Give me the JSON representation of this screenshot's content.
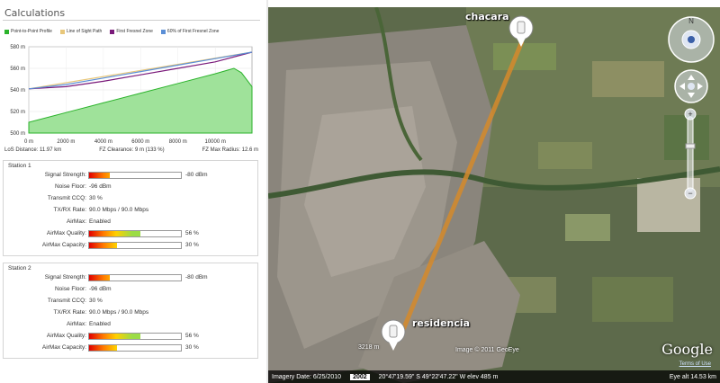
{
  "panel": {
    "title": "Calculations"
  },
  "legend": [
    {
      "label": "Point-to-Point Profile",
      "color": "#2bb32b"
    },
    {
      "label": "Line of Sight Path",
      "color": "#e8c77a"
    },
    {
      "label": "First Fresnel Zone",
      "color": "#7a1a7a"
    },
    {
      "label": "60% of First Fresnel Zone",
      "color": "#5b8fd6"
    }
  ],
  "chart_data": {
    "type": "area",
    "x_unit": "m",
    "xlim": [
      0,
      11970
    ],
    "ylim": [
      500,
      580
    ],
    "x_ticks": [
      "0 m",
      "2000 m",
      "4000 m",
      "6000 m",
      "8000 m",
      "10000 m"
    ],
    "y_ticks": [
      "500 m",
      "520 m",
      "540 m",
      "560 m",
      "580 m"
    ],
    "series": [
      {
        "name": "Point-to-Point Profile",
        "x": [
          0,
          2000,
          4000,
          6000,
          8000,
          10000,
          11000,
          11400,
          11970
        ],
        "y": [
          510,
          519,
          528,
          537,
          546,
          555,
          560,
          556,
          543
        ]
      },
      {
        "name": "Line of Sight Path",
        "x": [
          0,
          11970
        ],
        "y": [
          541,
          575
        ]
      },
      {
        "name": "First Fresnel Zone",
        "x": [
          0,
          2000,
          4000,
          6000,
          8000,
          10000,
          11970
        ],
        "y": [
          541,
          543,
          548,
          554,
          560,
          566,
          575
        ]
      },
      {
        "name": "60% of First Fresnel Zone",
        "x": [
          0,
          2000,
          4000,
          6000,
          8000,
          10000,
          11970
        ],
        "y": [
          541,
          545,
          551,
          557,
          563,
          569,
          575
        ]
      }
    ]
  },
  "stats": {
    "los": "LoS Distance: 11.97 km",
    "fz": "FZ Clearance: 9 m  (133 %)",
    "radius": "FZ Max Radius: 12.6 m"
  },
  "stations": [
    {
      "title": "Station 1",
      "signal_label": "Signal Strength:",
      "signal_value": "-80 dBm",
      "signal_level": 0.23,
      "noise_label": "Noise Floor:",
      "noise_value": "-96 dBm",
      "ccq_label": "Transmit CCQ:",
      "ccq_value": "30 %",
      "rate_label": "TX/RX Rate:",
      "rate_value": "90.0 Mbps / 90.0 Mbps",
      "airmax_label": "AirMax:",
      "airmax_value": "Enabled",
      "quality_label": "AirMax Quality:",
      "quality_value": "56 %",
      "quality_level": 0.56,
      "capacity_label": "AirMax Capacity:",
      "capacity_value": "30 %",
      "capacity_level": 0.3
    },
    {
      "title": "Station 2",
      "signal_label": "Signal Strength:",
      "signal_value": "-80 dBm",
      "signal_level": 0.23,
      "noise_label": "Noise Floor:",
      "noise_value": "-96 dBm",
      "ccq_label": "Transmit CCQ:",
      "ccq_value": "30 %",
      "rate_label": "TX/RX Rate:",
      "rate_value": "90.0 Mbps / 90.0 Mbps",
      "airmax_label": "AirMax:",
      "airmax_value": "Enabled",
      "quality_label": "AirMax Quality:",
      "quality_value": "56 %",
      "quality_level": 0.56,
      "capacity_label": "AirMax Capacity:",
      "capacity_value": "30 %",
      "capacity_level": 0.3
    }
  ],
  "map": {
    "pin_top_label": "chacara",
    "pin_bottom_label": "residencia",
    "scale": "3218 m",
    "attribution": "Image © 2011 GeoEye",
    "google": "Google",
    "terms": "Terms of Use",
    "compass": "N",
    "footer": {
      "imagery_date": "Imagery Date: 6/25/2010",
      "year": "2002",
      "coords": "20°47'19.59\" S   49°22'47.22\" W  elev  485 m",
      "eye_alt": "Eye alt   14.53 km"
    }
  }
}
